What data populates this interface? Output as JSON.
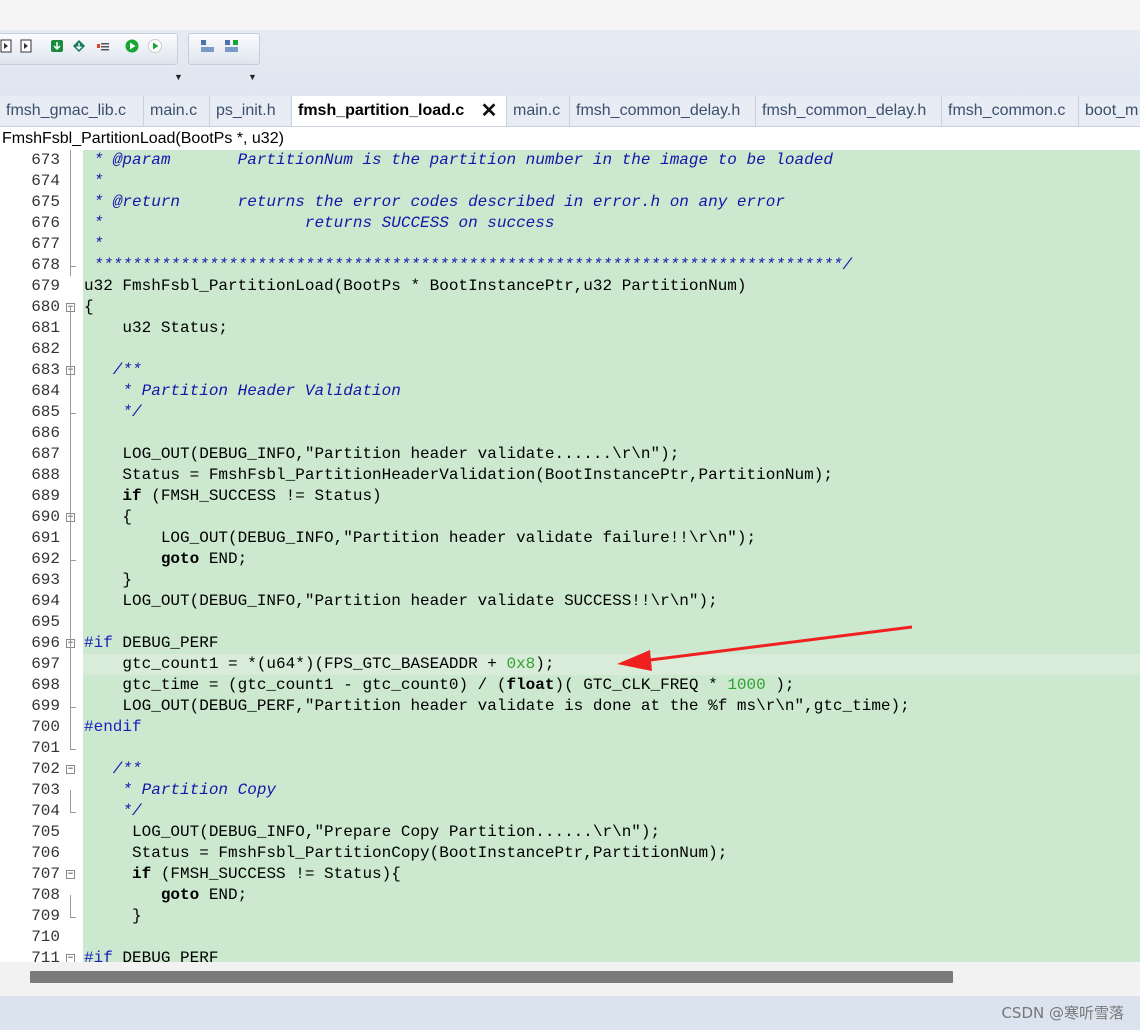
{
  "tabs": [
    {
      "label": "fmsh_gmac_lib.c"
    },
    {
      "label": "main.c"
    },
    {
      "label": "ps_init.h"
    },
    {
      "label": "fmsh_partition_load.c",
      "active": true
    },
    {
      "label": "main.c"
    },
    {
      "label": "fmsh_common_delay.h"
    },
    {
      "label": "fmsh_common_delay.h"
    },
    {
      "label": "fmsh_common.c"
    },
    {
      "label": "boot_m"
    }
  ],
  "close_glyph": "✕",
  "function_bar": "FmshFsbl_PartitionLoad(BootPs *, u32)",
  "toolbar": {
    "icons": [
      "page-back-icon",
      "page-forward-icon",
      "download-icon",
      "upload-icon",
      "list-icon",
      "run-icon",
      "play-icon",
      "toolbar-overflow-icon",
      "layout-icon",
      "layout-add-icon",
      "toolbar-overflow-icon"
    ]
  },
  "code_lines": [
    {
      "n": "673",
      "parts": [
        {
          "t": " * @param       PartitionNum is the partition number in the image to be loaded",
          "c": "com"
        }
      ]
    },
    {
      "n": "674",
      "parts": [
        {
          "t": " *",
          "c": "com"
        }
      ]
    },
    {
      "n": "675",
      "parts": [
        {
          "t": " * @return      returns the error codes described in error.h on any error",
          "c": "com"
        }
      ]
    },
    {
      "n": "676",
      "parts": [
        {
          "t": " *                     returns SUCCESS on success",
          "c": "com"
        }
      ]
    },
    {
      "n": "677",
      "parts": [
        {
          "t": " *",
          "c": "com"
        }
      ]
    },
    {
      "n": "678",
      "parts": [
        {
          "t": " ******************************************************************************/",
          "c": "com"
        }
      ]
    },
    {
      "n": "679",
      "parts": [
        {
          "t": "u32 FmshFsbl_PartitionLoad(BootPs * BootInstancePtr,u32 PartitionNum)"
        }
      ]
    },
    {
      "n": "680",
      "parts": [
        {
          "t": "{"
        }
      ]
    },
    {
      "n": "681",
      "parts": [
        {
          "t": "    u32 Status;"
        }
      ]
    },
    {
      "n": "682",
      "parts": [
        {
          "t": ""
        }
      ]
    },
    {
      "n": "683",
      "parts": [
        {
          "t": "   /**",
          "c": "com"
        }
      ]
    },
    {
      "n": "684",
      "parts": [
        {
          "t": "    * Partition Header Validation",
          "c": "com"
        }
      ]
    },
    {
      "n": "685",
      "parts": [
        {
          "t": "    */",
          "c": "com"
        }
      ]
    },
    {
      "n": "686",
      "parts": [
        {
          "t": ""
        }
      ]
    },
    {
      "n": "687",
      "parts": [
        {
          "t": "    LOG_OUT(DEBUG_INFO,\"Partition header validate......\\r\\n\");"
        }
      ]
    },
    {
      "n": "688",
      "parts": [
        {
          "t": "    Status = FmshFsbl_PartitionHeaderValidation(BootInstancePtr,PartitionNum);"
        }
      ]
    },
    {
      "n": "689",
      "parts": [
        {
          "t": "    "
        },
        {
          "t": "if",
          "c": "kw"
        },
        {
          "t": " (FMSH_SUCCESS != Status)"
        }
      ]
    },
    {
      "n": "690",
      "parts": [
        {
          "t": "    {"
        }
      ]
    },
    {
      "n": "691",
      "parts": [
        {
          "t": "        LOG_OUT(DEBUG_INFO,\"Partition header validate failure!!\\r\\n\");"
        }
      ]
    },
    {
      "n": "692",
      "parts": [
        {
          "t": "        "
        },
        {
          "t": "goto",
          "c": "kw"
        },
        {
          "t": " END;"
        }
      ]
    },
    {
      "n": "693",
      "parts": [
        {
          "t": "    }"
        }
      ]
    },
    {
      "n": "694",
      "parts": [
        {
          "t": "    LOG_OUT(DEBUG_INFO,\"Partition header validate SUCCESS!!\\r\\n\");"
        }
      ]
    },
    {
      "n": "695",
      "parts": [
        {
          "t": ""
        }
      ]
    },
    {
      "n": "696",
      "parts": [
        {
          "t": "#if",
          "c": "pp"
        },
        {
          "t": " DEBUG_PERF"
        }
      ]
    },
    {
      "n": "697",
      "parts": [
        {
          "t": "    gtc_count1 = *(u64*)(FPS_GTC_BASEADDR + "
        },
        {
          "t": "0x8",
          "c": "num"
        },
        {
          "t": ");"
        }
      ]
    },
    {
      "n": "698",
      "parts": [
        {
          "t": "    gtc_time = (gtc_count1 - gtc_count0) / ("
        },
        {
          "t": "float",
          "c": "kw"
        },
        {
          "t": ")( GTC_CLK_FREQ * "
        },
        {
          "t": "1000",
          "c": "num"
        },
        {
          "t": " );"
        }
      ]
    },
    {
      "n": "699",
      "parts": [
        {
          "t": "    LOG_OUT(DEBUG_PERF,\"Partition header validate is done at the %f ms\\r\\n\",gtc_time);"
        }
      ]
    },
    {
      "n": "700",
      "parts": [
        {
          "t": "#endif",
          "c": "pp"
        }
      ]
    },
    {
      "n": "701",
      "parts": [
        {
          "t": ""
        }
      ]
    },
    {
      "n": "702",
      "parts": [
        {
          "t": "   /**",
          "c": "com"
        }
      ]
    },
    {
      "n": "703",
      "parts": [
        {
          "t": "    * Partition Copy",
          "c": "com"
        }
      ]
    },
    {
      "n": "704",
      "parts": [
        {
          "t": "    */",
          "c": "com"
        }
      ]
    },
    {
      "n": "705",
      "parts": [
        {
          "t": "     LOG_OUT(DEBUG_INFO,\"Prepare Copy Partition......\\r\\n\");"
        }
      ]
    },
    {
      "n": "706",
      "parts": [
        {
          "t": "     Status = FmshFsbl_PartitionCopy(BootInstancePtr,PartitionNum);"
        }
      ]
    },
    {
      "n": "707",
      "parts": [
        {
          "t": "     "
        },
        {
          "t": "if",
          "c": "kw"
        },
        {
          "t": " (FMSH_SUCCESS != Status){"
        }
      ]
    },
    {
      "n": "708",
      "parts": [
        {
          "t": "        "
        },
        {
          "t": "goto",
          "c": "kw"
        },
        {
          "t": " END;"
        }
      ]
    },
    {
      "n": "709",
      "parts": [
        {
          "t": "     }"
        }
      ]
    },
    {
      "n": "710",
      "parts": [
        {
          "t": ""
        }
      ]
    },
    {
      "n": "711",
      "parts": [
        {
          "t": "#if",
          "c": "pp"
        },
        {
          "t": " DEBUG_PERF"
        }
      ]
    }
  ],
  "annotation": {
    "description": "red-arrow-annotation",
    "color": "#f02020"
  },
  "watermark": "CSDN @寒听雪落"
}
